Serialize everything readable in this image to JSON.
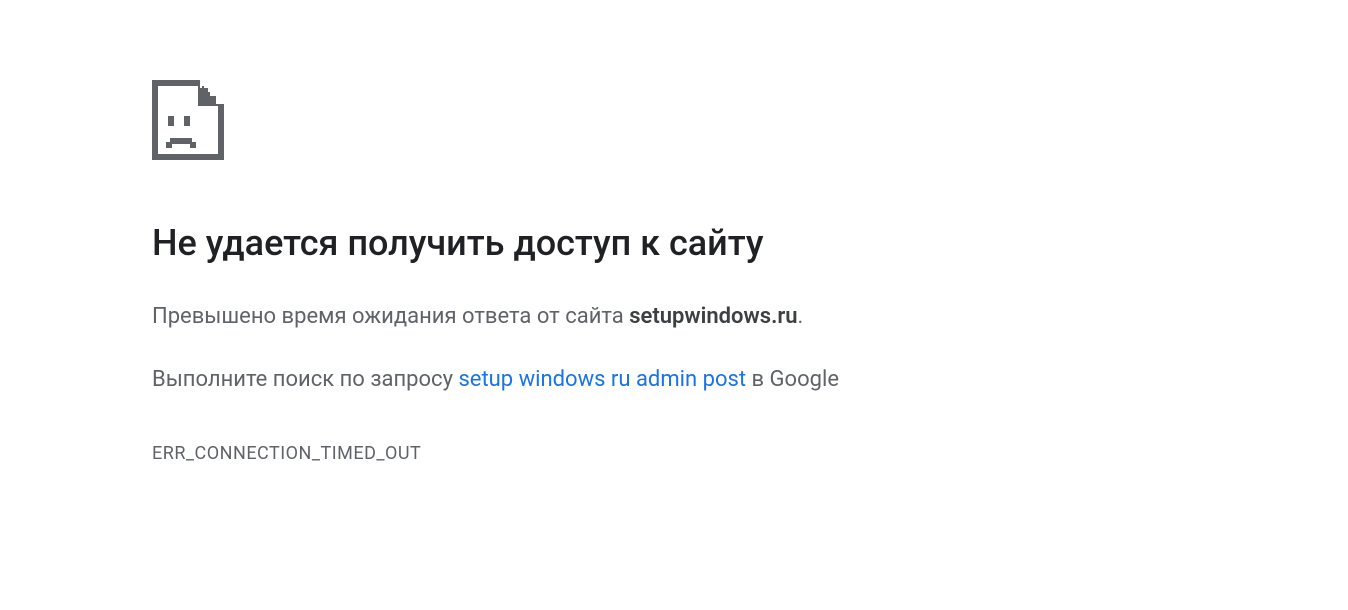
{
  "error": {
    "title": "Не удается получить доступ к сайту",
    "description_prefix": "Превышено время ожидания ответа от сайта ",
    "hostname": "setupwindows.ru",
    "description_suffix": ".",
    "suggestion_prefix": "Выполните поиск по запросу ",
    "search_query": "setup windows ru admin post",
    "suggestion_suffix": " в Google",
    "code": "ERR_CONNECTION_TIMED_OUT"
  }
}
